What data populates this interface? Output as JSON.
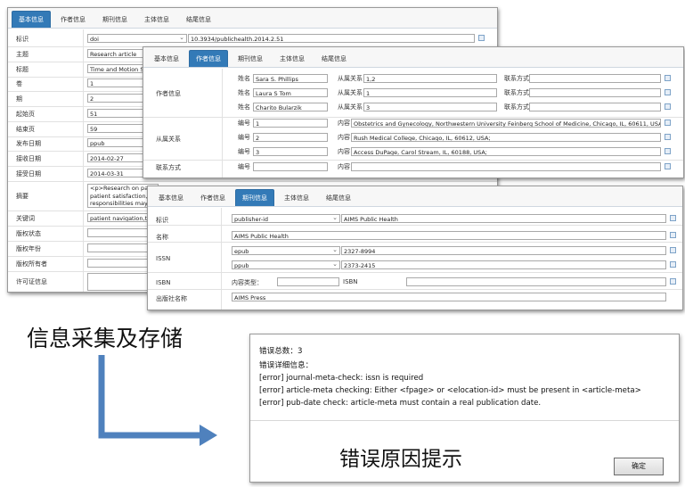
{
  "panel1": {
    "tabs": [
      "基本信息",
      "作者信息",
      "期刊信息",
      "主体信息",
      "结尾信息"
    ],
    "rows": [
      {
        "label": "标识",
        "value": "doi",
        "value2": "10.3934/publichealth.2014.2.51"
      },
      {
        "label": "主题",
        "value": "Research article"
      },
      {
        "label": "标题",
        "value": "Time and Motion Stud"
      },
      {
        "label": "卷",
        "value": "1"
      },
      {
        "label": "期",
        "value": "2"
      },
      {
        "label": "起始页",
        "value": "51"
      },
      {
        "label": "结束页",
        "value": "59"
      },
      {
        "label": "发布日期",
        "value": "ppub"
      },
      {
        "label": "接收日期",
        "value": "2014-02-27"
      },
      {
        "label": "接受日期",
        "value": "2014-03-31"
      },
      {
        "label": "摘要",
        "value": "<p>Research on patie",
        "value_line2": "patient satisfaction, ar",
        "value_line3": "responsibilities may lo"
      },
      {
        "label": "关键词",
        "value": "patient navigation,time"
      },
      {
        "label": "版权状态",
        "value": ""
      },
      {
        "label": "版权年份",
        "value": ""
      },
      {
        "label": "版权所有者",
        "value": ""
      },
      {
        "label": "许可证信息",
        "value": ""
      }
    ]
  },
  "panel2": {
    "tabs": [
      "基本信息",
      "作者信息",
      "期刊信息",
      "主体信息",
      "结尾信息"
    ],
    "author_group_label": "作者信息",
    "name_label": "姓名",
    "affil_label": "从属关系",
    "contact_label": "联系方式",
    "authors": [
      {
        "name": "Sara S. Phillips",
        "affil": "1,2"
      },
      {
        "name": "Laura S Tom",
        "affil": "1"
      },
      {
        "name": "Charito Bularzik",
        "affil": "3"
      }
    ],
    "affil_group_label": "从属关系",
    "id_label": "编号",
    "content_label": "内容",
    "affiliations": [
      {
        "id": "1",
        "content": "Obstetrics and Gynecology, Northwestern University Feinberg School of Medicine, Chicago, IL, 60611, USA;"
      },
      {
        "id": "2",
        "content": "Rush Medical College, Chicago, IL, 60612, USA;"
      },
      {
        "id": "3",
        "content": "Access DuPage, Carol Stream, IL, 60188, USA;"
      }
    ],
    "contact_group_label": "联系方式",
    "contact_content_label": "内容"
  },
  "panel3": {
    "tabs": [
      "基本信息",
      "作者信息",
      "期刊信息",
      "主体信息",
      "结尾信息"
    ],
    "id_label": "标识",
    "id_type": "publisher-id",
    "id_value": "AIMS Public Health",
    "name_label": "名称",
    "name_value": "AIMS Public Health",
    "issn_label": "ISSN",
    "issn": [
      {
        "type": "epub",
        "value": "2327-8994"
      },
      {
        "type": "ppub",
        "value": "2373-2415"
      }
    ],
    "isbn_label": "ISBN",
    "content_type_label": "内容类型：",
    "isbn_inner_label": "ISBN",
    "publisher_label": "出版社名称",
    "publisher_value": "AIMS Press"
  },
  "caption_left": "信息采集及存储",
  "caption_right": "错误原因提示",
  "dialog": {
    "count_label": "错误总数：3",
    "detail_label": "错误详细信息：",
    "errors": [
      "[error] journal-meta-check: issn is required",
      "[error] article-meta checking: Either <fpage> or <elocation-id> must be present in <article-meta>",
      "[error] pub-date check: article-meta must contain a real publication date."
    ],
    "ok_label": "确定"
  },
  "colors": {
    "active_tab": "#337ab7",
    "arrow": "#4f81bd"
  }
}
